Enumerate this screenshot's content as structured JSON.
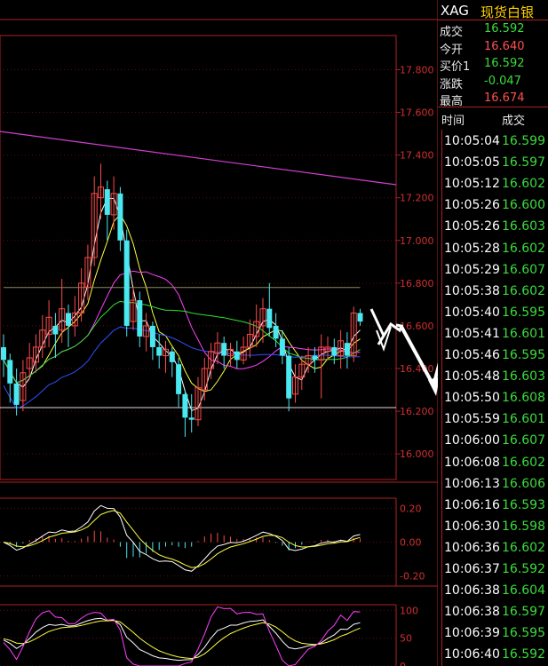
{
  "instrument": {
    "symbol": "XAG",
    "name": "现货白银"
  },
  "quote": [
    {
      "label": "成交",
      "value": "16.592",
      "tone": "g"
    },
    {
      "label": "今开",
      "value": "16.640",
      "tone": "r"
    },
    {
      "label": "买价1",
      "value": "16.592",
      "tone": "g"
    },
    {
      "label": "涨跌",
      "value": "-0.047",
      "tone": "g"
    },
    {
      "label": "最高",
      "value": "16.674",
      "tone": "r"
    }
  ],
  "ticks_header": {
    "time": "时间",
    "price": "成交"
  },
  "ticks": [
    {
      "time": "10:05:04",
      "price": "16.599"
    },
    {
      "time": "10:05:05",
      "price": "16.597"
    },
    {
      "time": "10:05:12",
      "price": "16.602"
    },
    {
      "time": "10:05:26",
      "price": "16.600"
    },
    {
      "time": "10:05:26",
      "price": "16.603"
    },
    {
      "time": "10:05:28",
      "price": "16.602"
    },
    {
      "time": "10:05:29",
      "price": "16.607"
    },
    {
      "time": "10:05:38",
      "price": "16.602"
    },
    {
      "time": "10:05:40",
      "price": "16.595"
    },
    {
      "time": "10:05:41",
      "price": "16.601"
    },
    {
      "time": "10:05:46",
      "price": "16.595"
    },
    {
      "time": "10:05:48",
      "price": "16.603"
    },
    {
      "time": "10:05:50",
      "price": "16.608"
    },
    {
      "time": "10:05:59",
      "price": "16.601"
    },
    {
      "time": "10:06:00",
      "price": "16.607"
    },
    {
      "time": "10:06:08",
      "price": "16.602"
    },
    {
      "time": "10:06:13",
      "price": "16.606"
    },
    {
      "time": "10:06:16",
      "price": "16.593"
    },
    {
      "time": "10:06:30",
      "price": "16.598"
    },
    {
      "time": "10:06:36",
      "price": "16.602"
    },
    {
      "time": "10:06:37",
      "price": "16.592"
    },
    {
      "time": "10:06:38",
      "price": "16.604"
    },
    {
      "time": "10:06:38",
      "price": "16.597"
    },
    {
      "time": "10:06:39",
      "price": "16.595"
    },
    {
      "time": "10:06:40",
      "price": "16.592"
    }
  ],
  "price_axis": [
    "17.800",
    "17.600",
    "17.400",
    "17.200",
    "17.000",
    "16.800",
    "16.600",
    "16.400",
    "16.200",
    "16.000"
  ],
  "price_range": [
    15.88,
    17.96
  ],
  "macd_axis": [
    "0.20",
    "0.00",
    "-0.20"
  ],
  "macd_range": [
    -0.26,
    0.26
  ],
  "kdj_axis": [
    "100",
    "50",
    "0"
  ],
  "kdj_range": [
    0,
    110
  ],
  "candles": [
    [
      16.5,
      16.44,
      16.56,
      16.36
    ],
    [
      16.44,
      16.33,
      16.47,
      16.24
    ],
    [
      16.33,
      16.23,
      16.4,
      16.18
    ],
    [
      16.25,
      16.38,
      16.44,
      16.2
    ],
    [
      16.4,
      16.45,
      16.52,
      16.35
    ],
    [
      16.43,
      16.5,
      16.56,
      16.38
    ],
    [
      16.5,
      16.58,
      16.65,
      16.45
    ],
    [
      16.56,
      16.64,
      16.72,
      16.5
    ],
    [
      16.6,
      16.56,
      16.66,
      16.45
    ],
    [
      16.58,
      16.68,
      16.82,
      16.52
    ],
    [
      16.66,
      16.6,
      16.7,
      16.5
    ],
    [
      16.6,
      16.66,
      16.74,
      16.55
    ],
    [
      16.66,
      16.8,
      16.87,
      16.62
    ],
    [
      16.78,
      16.92,
      16.98,
      16.72
    ],
    [
      16.92,
      17.22,
      17.3,
      16.88
    ],
    [
      17.2,
      17.25,
      17.36,
      17.1
    ],
    [
      17.24,
      17.12,
      17.28,
      17.0
    ],
    [
      17.12,
      17.22,
      17.3,
      17.05
    ],
    [
      17.22,
      17.0,
      17.25,
      16.95
    ],
    [
      17.0,
      16.6,
      17.05,
      16.55
    ],
    [
      16.62,
      16.72,
      16.78,
      16.58
    ],
    [
      16.72,
      16.55,
      16.76,
      16.5
    ],
    [
      16.55,
      16.6,
      16.66,
      16.48
    ],
    [
      16.6,
      16.5,
      16.62,
      16.44
    ],
    [
      16.5,
      16.46,
      16.56,
      16.4
    ],
    [
      16.46,
      16.49,
      16.53,
      16.38
    ],
    [
      16.48,
      16.43,
      16.5,
      16.36
    ],
    [
      16.42,
      16.28,
      16.45,
      16.22
    ],
    [
      16.28,
      16.17,
      16.3,
      16.08
    ],
    [
      16.17,
      16.16,
      16.28,
      16.1
    ],
    [
      16.16,
      16.31,
      16.36,
      16.13
    ],
    [
      16.3,
      16.4,
      16.45,
      16.25
    ],
    [
      16.4,
      16.48,
      16.52,
      16.35
    ],
    [
      16.47,
      16.52,
      16.57,
      16.42
    ],
    [
      16.52,
      16.46,
      16.55,
      16.4
    ],
    [
      16.46,
      16.49,
      16.52,
      16.41
    ],
    [
      16.48,
      16.44,
      16.53,
      16.4
    ],
    [
      16.44,
      16.5,
      16.55,
      16.42
    ],
    [
      16.5,
      16.56,
      16.63,
      16.45
    ],
    [
      16.55,
      16.62,
      16.7,
      16.5
    ],
    [
      16.6,
      16.68,
      16.73,
      16.52
    ],
    [
      16.68,
      16.59,
      16.8,
      16.55
    ],
    [
      16.6,
      16.54,
      16.66,
      16.5
    ],
    [
      16.54,
      16.46,
      16.58,
      16.42
    ],
    [
      16.46,
      16.26,
      16.5,
      16.2
    ],
    [
      16.28,
      16.36,
      16.42,
      16.24
    ],
    [
      16.36,
      16.42,
      16.46,
      16.3
    ],
    [
      16.42,
      16.46,
      16.5,
      16.38
    ],
    [
      16.46,
      16.44,
      16.5,
      16.38
    ],
    [
      16.44,
      16.5,
      16.56,
      16.26
    ],
    [
      16.48,
      16.5,
      16.55,
      16.44
    ],
    [
      16.5,
      16.46,
      16.54,
      16.42
    ],
    [
      16.46,
      16.53,
      16.58,
      16.4
    ],
    [
      16.52,
      16.46,
      16.57,
      16.4
    ],
    [
      16.46,
      16.66,
      16.69,
      16.43
    ],
    [
      16.66,
      16.62,
      16.68,
      16.6
    ]
  ],
  "wave_annotation": "white zigzag arrows"
}
